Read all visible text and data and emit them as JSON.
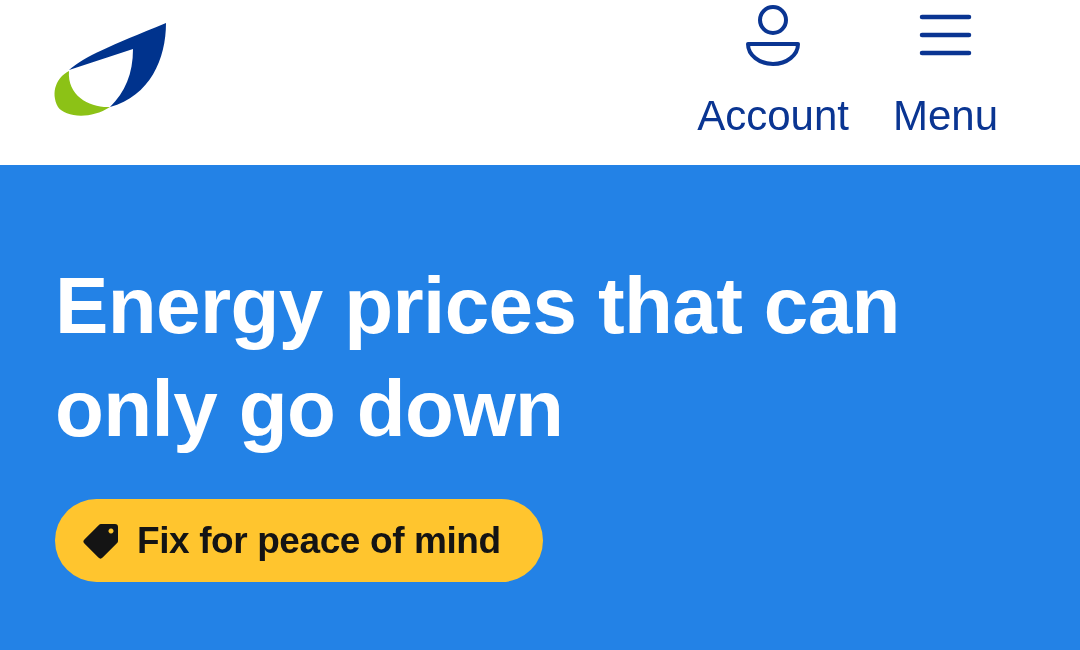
{
  "header": {
    "actions": [
      {
        "kind": "account",
        "label": "Account"
      },
      {
        "kind": "menu",
        "label": "Menu"
      }
    ]
  },
  "hero": {
    "title": "Energy prices that can only go down",
    "tag": {
      "label": "Fix for peace of mind"
    }
  }
}
